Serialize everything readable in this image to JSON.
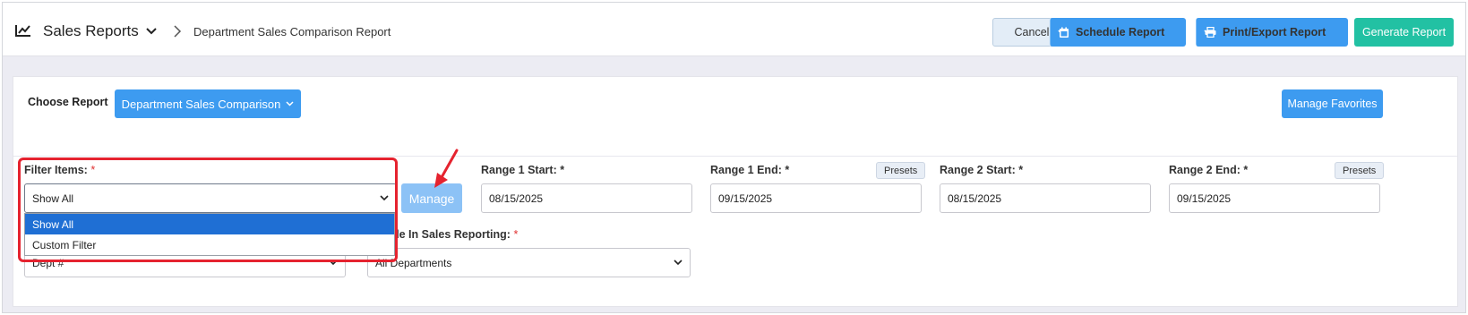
{
  "header": {
    "title": "Sales Reports",
    "breadcrumb": "Department Sales Comparison Report",
    "cancel_label": "Cancel",
    "schedule_label": "Schedule Report",
    "print_label": "Print/Export Report",
    "generate_label": "Generate Report"
  },
  "report": {
    "choose_label": "Choose Report",
    "selected_report": "Department Sales Comparison",
    "manage_favorites_label": "Manage Favorites"
  },
  "filters": {
    "filter_items_label": "Filter Items:",
    "filter_items_value": "Show All",
    "filter_options": [
      "Show All",
      "Custom Filter"
    ],
    "manage_label": "Manage",
    "range1_start_label": "Range 1 Start:",
    "range1_start_value": "08/15/2025",
    "range1_end_label": "Range 1 End:",
    "range1_end_value": "09/15/2025",
    "range2_start_label": "Range 2 Start:",
    "range2_start_value": "08/15/2025",
    "range2_end_label": "Range 2 End:",
    "range2_end_value": "09/15/2025",
    "presets_label": "Presets",
    "sort_value": "Dept #",
    "include_label": "de In Sales Reporting:",
    "include_value": "All Departments",
    "required_mark": "*"
  },
  "colors": {
    "primary": "#3d9bf0",
    "success": "#22c1a3",
    "highlight": "#e5232f",
    "selected_option": "#1f6fd4"
  }
}
